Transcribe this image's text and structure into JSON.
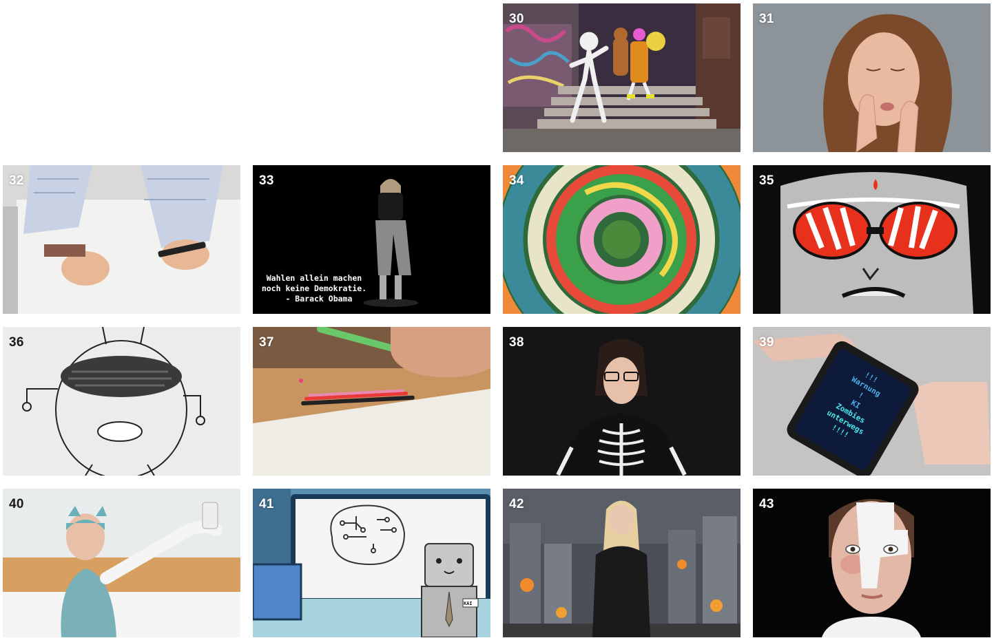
{
  "tiles": [
    {
      "number": "30",
      "scene": "graffiti-stairs-animation"
    },
    {
      "number": "31",
      "scene": "woman-hands-on-face"
    },
    {
      "number": "32",
      "scene": "hands-with-marker-on-paper"
    },
    {
      "number": "33",
      "scene": "person-on-black-stage",
      "caption": "Wahlen allein machen\nnoch keine Demokratie.\n  - Barack Obama"
    },
    {
      "number": "34",
      "scene": "colorful-swirl"
    },
    {
      "number": "35",
      "scene": "comic-face-red-goggles"
    },
    {
      "number": "36",
      "scene": "pencil-drawing-creature"
    },
    {
      "number": "37",
      "scene": "hand-with-colored-pencils"
    },
    {
      "number": "38",
      "scene": "girl-skeleton-sweater"
    },
    {
      "number": "39",
      "scene": "phone-warning-message",
      "phone_text": "!!!\nWarnung\n!\nKI\nZombies\nunterwegs\n!!!!"
    },
    {
      "number": "40",
      "scene": "girl-in-bed-with-phone"
    },
    {
      "number": "41",
      "scene": "robot-with-circuit-brain",
      "badge": "KAI"
    },
    {
      "number": "42",
      "scene": "girl-in-burning-city"
    },
    {
      "number": "43",
      "scene": "face-with-white-paint"
    }
  ],
  "colors": {
    "background": "#ffffff",
    "number_label": "#ffffff",
    "number_label_dark": "#1a1a1a"
  }
}
